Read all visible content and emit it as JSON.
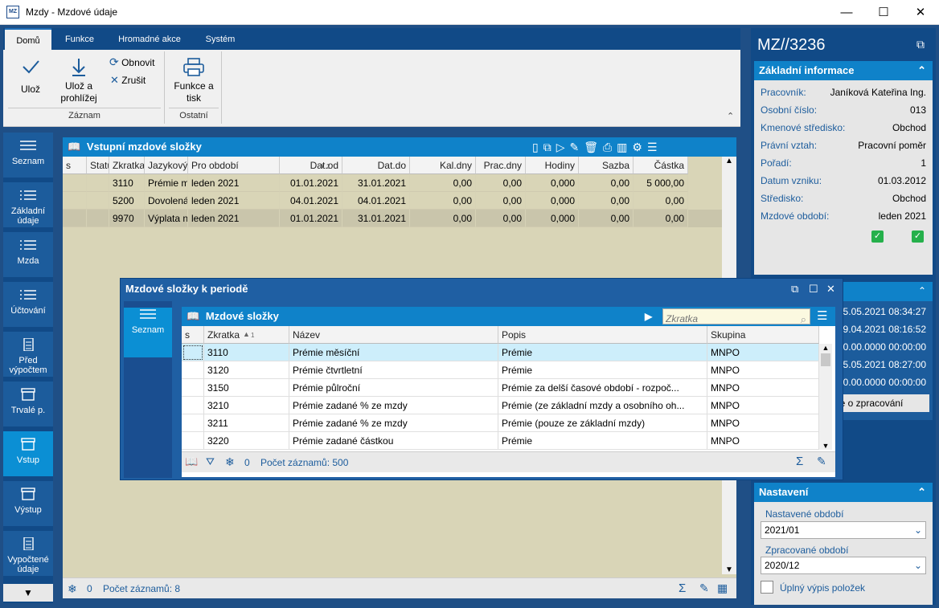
{
  "window": {
    "title": "Mzdy - Mzdové údaje",
    "app_icon": "MZ"
  },
  "ribbon": {
    "tabs": [
      "Domů",
      "Funkce",
      "Hromadné akce",
      "Systém"
    ],
    "buttons": {
      "save": "Ulož",
      "save_browse_1": "Ulož a",
      "save_browse_2": "prohlížej",
      "refresh": "Obnovit",
      "cancel": "Zrušit",
      "func_print_1": "Funkce a",
      "func_print_2": "tisk"
    },
    "groups": {
      "record": "Záznam",
      "other": "Ostatní"
    }
  },
  "nav": [
    {
      "label1": "Seznam",
      "label2": ""
    },
    {
      "label1": "Základní",
      "label2": "údaje"
    },
    {
      "label1": "Mzda",
      "label2": ""
    },
    {
      "label1": "Účtování",
      "label2": ""
    },
    {
      "label1": "Před",
      "label2": "výpočtem"
    },
    {
      "label1": "Trvalé p.",
      "label2": ""
    },
    {
      "label1": "Vstup",
      "label2": ""
    },
    {
      "label1": "Výstup",
      "label2": ""
    },
    {
      "label1": "Vypočtené",
      "label2": "údaje"
    }
  ],
  "panel": {
    "title": "Vstupní mzdové složky",
    "columns": [
      "s",
      "Status",
      "Zkratka",
      "Jazykový název",
      "Pro období",
      "Dat.od",
      "Dat.do",
      "Kal.dny",
      "Prac.dny",
      "Hodiny",
      "Sazba",
      "Částka"
    ],
    "sort_marker": "2",
    "rows": [
      [
        "",
        "",
        "3110",
        "Prémie měsíční",
        "leden 2021",
        "01.01.2021",
        "31.01.2021",
        "0,00",
        "0,00",
        "0,000",
        "0,00",
        "5 000,00"
      ],
      [
        "",
        "",
        "5200",
        "Dovolená",
        "leden 2021",
        "04.01.2021",
        "04.01.2021",
        "0,00",
        "0,00",
        "0,000",
        "0,00",
        "0,00"
      ],
      [
        "",
        "",
        "9970",
        "Výplata na účet",
        "leden 2021",
        "01.01.2021",
        "31.01.2021",
        "0,00",
        "0,00",
        "0,000",
        "0,00",
        "0,00"
      ]
    ],
    "footer": {
      "filter_count": "0",
      "records": "Počet záznamů: 8"
    }
  },
  "side": {
    "doc_id": "MZ//3236",
    "basic_title": "Základní informace",
    "fields": [
      {
        "k": "Pracovník:",
        "v": "Janíková Kateřina Ing."
      },
      {
        "k": "Osobní číslo:",
        "v": "013"
      },
      {
        "k": "Kmenové středisko:",
        "v": "Obchod"
      },
      {
        "k": "Právní vztah:",
        "v": "Pracovní poměr"
      },
      {
        "k": "Pořadí:",
        "v": "1"
      },
      {
        "k": "Datum vzniku:",
        "v": "01.03.2012"
      },
      {
        "k": "Středisko:",
        "v": "Obchod"
      },
      {
        "k": "Mzdové období:",
        "v": "leden 2021"
      }
    ],
    "log": [
      "2 25.05.2021 08:34:27",
      "2 29.04.2021 08:16:52",
      "00.00.0000 00:00:00",
      "2 25.05.2021 08:27:00",
      "00.00.0000 00:00:00"
    ],
    "log_button": "je o zpracování",
    "settings": {
      "title": "Nastavení",
      "set_period_label": "Nastavené období",
      "set_period": "2021/01",
      "proc_period_label": "Zpracované období",
      "proc_period": "2020/12",
      "full_list": "Úplný výpis položek"
    }
  },
  "dialog": {
    "title": "Mzdové složky k periodě",
    "nav_label": "Seznam",
    "list_title": "Mzdové složky",
    "search_placeholder": "Zkratka",
    "columns": [
      "s",
      "Zkratka",
      "Název",
      "Popis",
      "Skupina"
    ],
    "sort_marker": "1",
    "rows": [
      [
        "",
        "3110",
        "Prémie měsíční",
        "Prémie",
        "MNPO"
      ],
      [
        "",
        "3120",
        "Prémie čtvrtletní",
        "Prémie",
        "MNPO"
      ],
      [
        "",
        "3150",
        "Prémie půlroční",
        "Prémie za delší časové období - rozpoč...",
        "MNPO"
      ],
      [
        "",
        "3210",
        "Prémie zadané % ze mzdy",
        "Prémie (ze základní mzdy a osobního oh...",
        "MNPO"
      ],
      [
        "",
        "3211",
        "Prémie zadané % ze mzdy",
        "Prémie (pouze ze základní mzdy)",
        "MNPO"
      ],
      [
        "",
        "3220",
        "Prémie zadané částkou",
        "Prémie",
        "MNPO"
      ]
    ],
    "footer": {
      "filter_count": "0",
      "records": "Počet záznamů: 500"
    }
  },
  "colors": {
    "accent": "#0f82c9",
    "dark": "#114a87",
    "row_bg": "#d9d5b7",
    "active_nav": "#0b8fd4"
  }
}
